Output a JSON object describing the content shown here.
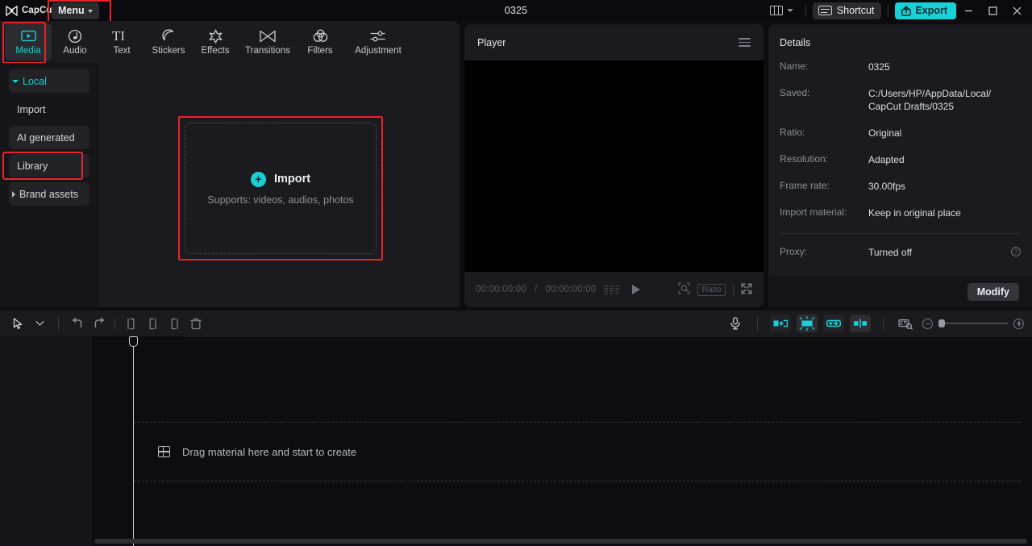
{
  "titlebar": {
    "brand": "CapCut",
    "brand_icon": "capcut-logo-icon",
    "menu_label": "Menu",
    "project_title": "0325",
    "layout_icon": "layout-panels-icon",
    "shortcut_label": "Shortcut",
    "shortcut_icon": "keyboard-icon",
    "export_label": "Export",
    "export_icon": "upload-icon",
    "minimize_icon": "minimize-icon",
    "maximize_icon": "maximize-icon",
    "close_icon": "close-icon"
  },
  "tabs": [
    {
      "label": "Media",
      "icon": "media-play-box-icon",
      "active": true
    },
    {
      "label": "Audio",
      "icon": "music-note-icon",
      "active": false
    },
    {
      "label": "Text",
      "icon": "text-ti-icon",
      "active": false
    },
    {
      "label": "Stickers",
      "icon": "sticker-moon-icon",
      "active": false
    },
    {
      "label": "Effects",
      "icon": "effects-sparkle-icon",
      "active": false
    },
    {
      "label": "Transitions",
      "icon": "transitions-bowtie-icon",
      "active": false
    },
    {
      "label": "Filters",
      "icon": "filters-circles-icon",
      "active": false
    },
    {
      "label": "Adjustment",
      "icon": "adjustment-sliders-icon",
      "active": false
    }
  ],
  "sidebar": {
    "items": [
      {
        "label": "Local",
        "style": "accent-filled",
        "caret": "down"
      },
      {
        "label": "Import",
        "style": "plain",
        "caret": "none"
      },
      {
        "label": "AI generated",
        "style": "filled",
        "caret": "none"
      },
      {
        "label": "Library",
        "style": "filled",
        "caret": "none",
        "highlighted": true
      },
      {
        "label": "Brand assets",
        "style": "filled",
        "caret": "right"
      }
    ]
  },
  "media_panel": {
    "import_label": "Import",
    "import_sub": "Supports: videos, audios, photos",
    "plus_icon": "plus-circle-icon"
  },
  "player": {
    "title": "Player",
    "menu_icon": "hamburger-menu-icon",
    "current_time": "00:00:00:00",
    "separator": "/",
    "total_time": "00:00:00:00",
    "frames_icon": "frames-icon",
    "play_icon": "play-icon",
    "zoom_icon": "magnify-frame-icon",
    "ratio_label": "Ratio",
    "fullscreen_icon": "fullscreen-icon"
  },
  "details": {
    "title": "Details",
    "rows": [
      {
        "key": "Name:",
        "value": "0325"
      },
      {
        "key": "Saved:",
        "value": "C:/Users/HP/AppData/Local/\nCapCut Drafts/0325"
      },
      {
        "key": "Ratio:",
        "value": "Original"
      },
      {
        "key": "Resolution:",
        "value": "Adapted"
      },
      {
        "key": "Frame rate:",
        "value": "30.00fps"
      },
      {
        "key": "Import material:",
        "value": "Keep in original place"
      },
      {
        "key": "Proxy:",
        "value": "Turned off",
        "help_icon": "question-mark-icon"
      }
    ],
    "modify_label": "Modify"
  },
  "timeline_toolbar": {
    "left_icons": [
      "cursor-select-icon",
      "chevron-down-icon",
      "undo-icon",
      "redo-icon",
      "split-left-icon",
      "split-icon",
      "split-right-icon",
      "delete-icon"
    ],
    "right_icons": [
      "microphone-icon",
      "auto-cut-icon",
      "auto-adjust-icon",
      "link-clip-icon",
      "split-clip-icon",
      "keyframe-camera-icon"
    ],
    "zoom_out_icon": "zoom-out-icon",
    "zoom_in_icon": "zoom-in-icon"
  },
  "timeline": {
    "drop_hint": "Drag material here and start to create",
    "drop_icon": "film-strip-icon",
    "playhead_icon": "playhead-icon"
  },
  "colors": {
    "accent": "#18d1d8",
    "highlight": "#e8232a",
    "panel": "#1b1b1f",
    "background": "#0d0d0f",
    "sidebar": "#161619"
  }
}
